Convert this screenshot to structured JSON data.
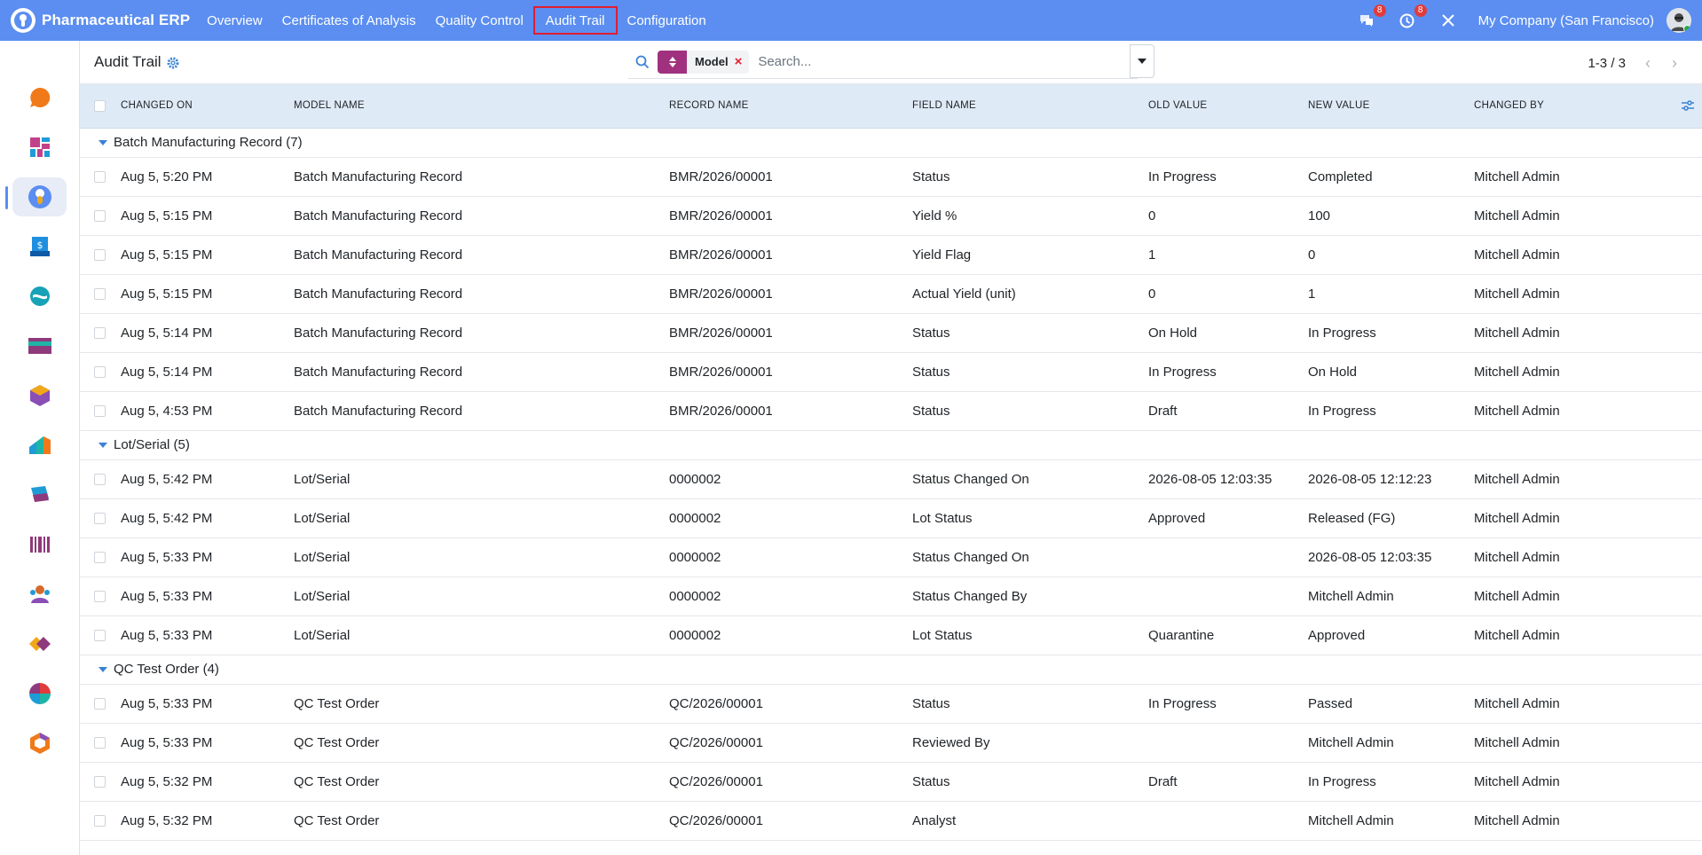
{
  "app": {
    "name": "Pharmaceutical ERP",
    "menu": [
      {
        "label": "Overview"
      },
      {
        "label": "Certificates of Analysis"
      },
      {
        "label": "Quality Control"
      },
      {
        "label": "Audit Trail",
        "active": true
      },
      {
        "label": "Configuration"
      }
    ],
    "messages_badge": "8",
    "activity_badge": "8",
    "company": "My Company (San Francisco)"
  },
  "control": {
    "title": "Audit Trail",
    "facet_label": "Model",
    "search_placeholder": "Search...",
    "pager_value": "1-3 / 3"
  },
  "table": {
    "headers": {
      "changed_on": "CHANGED ON",
      "model_name": "MODEL NAME",
      "record_name": "RECORD NAME",
      "field_name": "FIELD NAME",
      "old_value": "OLD VALUE",
      "new_value": "NEW VALUE",
      "changed_by": "CHANGED BY"
    },
    "groups": [
      {
        "label": "Batch Manufacturing Record (7)",
        "rows": [
          {
            "changed_on": "Aug 5, 5:20 PM",
            "model": "Batch Manufacturing Record",
            "record": "BMR/2026/00001",
            "field": "Status",
            "old": "In Progress",
            "new": "Completed",
            "by": "Mitchell Admin"
          },
          {
            "changed_on": "Aug 5, 5:15 PM",
            "model": "Batch Manufacturing Record",
            "record": "BMR/2026/00001",
            "field": "Yield %",
            "old": "0",
            "new": "100",
            "by": "Mitchell Admin"
          },
          {
            "changed_on": "Aug 5, 5:15 PM",
            "model": "Batch Manufacturing Record",
            "record": "BMR/2026/00001",
            "field": "Yield Flag",
            "old": "1",
            "new": "0",
            "by": "Mitchell Admin"
          },
          {
            "changed_on": "Aug 5, 5:15 PM",
            "model": "Batch Manufacturing Record",
            "record": "BMR/2026/00001",
            "field": "Actual Yield (unit)",
            "old": "0",
            "new": "1",
            "by": "Mitchell Admin"
          },
          {
            "changed_on": "Aug 5, 5:14 PM",
            "model": "Batch Manufacturing Record",
            "record": "BMR/2026/00001",
            "field": "Status",
            "old": "On Hold",
            "new": "In Progress",
            "by": "Mitchell Admin"
          },
          {
            "changed_on": "Aug 5, 5:14 PM",
            "model": "Batch Manufacturing Record",
            "record": "BMR/2026/00001",
            "field": "Status",
            "old": "In Progress",
            "new": "On Hold",
            "by": "Mitchell Admin"
          },
          {
            "changed_on": "Aug 5, 4:53 PM",
            "model": "Batch Manufacturing Record",
            "record": "BMR/2026/00001",
            "field": "Status",
            "old": "Draft",
            "new": "In Progress",
            "by": "Mitchell Admin"
          }
        ]
      },
      {
        "label": "Lot/Serial (5)",
        "rows": [
          {
            "changed_on": "Aug 5, 5:42 PM",
            "model": "Lot/Serial",
            "record": "0000002",
            "field": "Status Changed On",
            "old": "2026-08-05 12:03:35",
            "new": "2026-08-05 12:12:23",
            "by": "Mitchell Admin"
          },
          {
            "changed_on": "Aug 5, 5:42 PM",
            "model": "Lot/Serial",
            "record": "0000002",
            "field": "Lot Status",
            "old": "Approved",
            "new": "Released (FG)",
            "by": "Mitchell Admin"
          },
          {
            "changed_on": "Aug 5, 5:33 PM",
            "model": "Lot/Serial",
            "record": "0000002",
            "field": "Status Changed On",
            "old": "",
            "new": "2026-08-05 12:03:35",
            "by": "Mitchell Admin"
          },
          {
            "changed_on": "Aug 5, 5:33 PM",
            "model": "Lot/Serial",
            "record": "0000002",
            "field": "Status Changed By",
            "old": "",
            "new": "Mitchell Admin",
            "by": "Mitchell Admin"
          },
          {
            "changed_on": "Aug 5, 5:33 PM",
            "model": "Lot/Serial",
            "record": "0000002",
            "field": "Lot Status",
            "old": "Quarantine",
            "new": "Approved",
            "by": "Mitchell Admin"
          }
        ]
      },
      {
        "label": "QC Test Order (4)",
        "rows": [
          {
            "changed_on": "Aug 5, 5:33 PM",
            "model": "QC Test Order",
            "record": "QC/2026/00001",
            "field": "Status",
            "old": "In Progress",
            "new": "Passed",
            "by": "Mitchell Admin"
          },
          {
            "changed_on": "Aug 5, 5:33 PM",
            "model": "QC Test Order",
            "record": "QC/2026/00001",
            "field": "Reviewed By",
            "old": "",
            "new": "Mitchell Admin",
            "by": "Mitchell Admin"
          },
          {
            "changed_on": "Aug 5, 5:32 PM",
            "model": "QC Test Order",
            "record": "QC/2026/00001",
            "field": "Status",
            "old": "Draft",
            "new": "In Progress",
            "by": "Mitchell Admin"
          },
          {
            "changed_on": "Aug 5, 5:32 PM",
            "model": "QC Test Order",
            "record": "QC/2026/00001",
            "field": "Analyst",
            "old": "",
            "new": "Mitchell Admin",
            "by": "Mitchell Admin"
          }
        ]
      }
    ]
  },
  "sidebar": {
    "apps": [
      {
        "icon": "discuss-icon",
        "color": "#f07a1a"
      },
      {
        "icon": "dashboard-icon",
        "color": "#c2418b"
      },
      {
        "icon": "pharma-erp-icon",
        "color": "#5b8ef0",
        "active": true
      },
      {
        "icon": "invoicing-icon",
        "color": "#1f8fe0"
      },
      {
        "icon": "sync-icon",
        "color": "#17a2b8"
      },
      {
        "icon": "card-icon",
        "color": "#8e3a7c"
      },
      {
        "icon": "cube-icon",
        "color": "#8a4fb5"
      },
      {
        "icon": "inventory-icon",
        "color": "#1f9bd6"
      },
      {
        "icon": "flag-icon",
        "color": "#1f9bd6"
      },
      {
        "icon": "barcode-icon",
        "color": "#8e3a7c"
      },
      {
        "icon": "employees-icon",
        "color": "#d56a2a"
      },
      {
        "icon": "diamond-icon",
        "color": "#f0a81a"
      },
      {
        "icon": "pie-icon",
        "color": "#1fb5a6"
      },
      {
        "icon": "hexagon-icon",
        "color": "#f07a1a"
      }
    ]
  },
  "colors": {
    "navbar": "#5b8ef0",
    "header_bg": "#dfeaf7",
    "facet_accent": "#a0317f",
    "active_outline": "#e11d2e"
  }
}
